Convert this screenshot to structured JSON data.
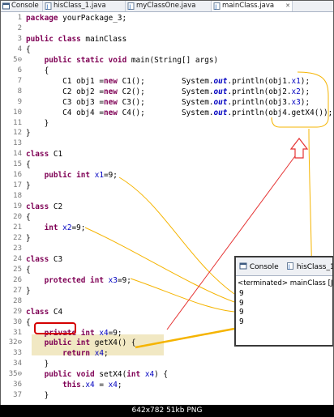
{
  "tabs": [
    {
      "label": "Console",
      "icon": "console-icon"
    },
    {
      "label": "hisClass_1.java",
      "icon": "java-file-icon"
    },
    {
      "label": "myClassOne.java",
      "icon": "java-file-icon"
    },
    {
      "label": "mainClass.java",
      "icon": "java-file-icon"
    }
  ],
  "tab_close": "✕",
  "lines": [
    {
      "n": "1",
      "text": "package yourPackage_3;"
    },
    {
      "n": "2",
      "text": ""
    },
    {
      "n": "3",
      "text": "public class mainClass"
    },
    {
      "n": "4",
      "text": "{"
    },
    {
      "n": "5⊖",
      "text": "    public static void main(String[] args)"
    },
    {
      "n": "6",
      "text": "    {"
    },
    {
      "n": "7",
      "text": "        C1 obj1 =new C1();        System.out.println(obj1.x1);"
    },
    {
      "n": "8",
      "text": "        C2 obj2 =new C2();        System.out.println(obj2.x2);"
    },
    {
      "n": "9",
      "text": "        C3 obj3 =new C3();        System.out.println(obj3.x3);"
    },
    {
      "n": "10",
      "text": "        C4 obj4 =new C4();        System.out.println(obj4.getX4());"
    },
    {
      "n": "11",
      "text": "    }"
    },
    {
      "n": "12",
      "text": "}"
    },
    {
      "n": "13",
      "text": ""
    },
    {
      "n": "14",
      "text": "class C1"
    },
    {
      "n": "15",
      "text": "{"
    },
    {
      "n": "16",
      "text": "    public int x1=9;"
    },
    {
      "n": "17",
      "text": "}"
    },
    {
      "n": "18",
      "text": ""
    },
    {
      "n": "19",
      "text": "class C2"
    },
    {
      "n": "20",
      "text": "{"
    },
    {
      "n": "21",
      "text": "    int x2=9;"
    },
    {
      "n": "22",
      "text": "}"
    },
    {
      "n": "23",
      "text": ""
    },
    {
      "n": "24",
      "text": "class C3"
    },
    {
      "n": "25",
      "text": "{"
    },
    {
      "n": "26",
      "text": "    protected int x3=9;"
    },
    {
      "n": "27",
      "text": "}"
    },
    {
      "n": "28",
      "text": ""
    },
    {
      "n": "29",
      "text": "class C4"
    },
    {
      "n": "30",
      "text": "{"
    },
    {
      "n": "31",
      "text": "    private int x4=9;"
    },
    {
      "n": "32⊖",
      "text": "    public int getX4() {"
    },
    {
      "n": "33",
      "text": "        return x4;"
    },
    {
      "n": "34",
      "text": "    }"
    },
    {
      "n": "35⊖",
      "text": "    public void setX4(int x4) {"
    },
    {
      "n": "36",
      "text": "        this.x4 = x4;"
    },
    {
      "n": "37",
      "text": "    }"
    }
  ],
  "console": {
    "tab1": "Console",
    "tab2": "hisClass_1",
    "terminated": "<terminated> mainClass [Ja",
    "output": [
      "9",
      "9",
      "9",
      "9"
    ]
  },
  "status_bar": "642x782  51kb  PNG",
  "colors": {
    "keyword": "#7f0055",
    "field": "#0000c0",
    "annotation": "#f5b400",
    "highlight_box": "#d40000"
  }
}
